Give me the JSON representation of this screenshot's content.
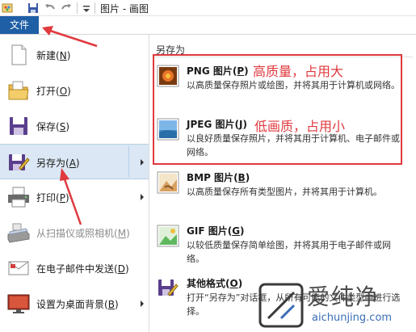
{
  "window": {
    "title": "图片 - 画图"
  },
  "quick_access": {
    "icons": [
      "paint-app-icon",
      "save-icon",
      "undo-icon",
      "redo-icon",
      "customize-dropdown-icon"
    ]
  },
  "file_tab": {
    "label": "文件"
  },
  "left_menu": {
    "items": [
      {
        "label": "新建",
        "key": "N",
        "icon": "new-file-icon",
        "enabled": true,
        "has_submenu": false
      },
      {
        "label": "打开",
        "key": "O",
        "icon": "open-folder-icon",
        "enabled": true,
        "has_submenu": false
      },
      {
        "label": "保存",
        "key": "S",
        "icon": "save-icon",
        "enabled": true,
        "has_submenu": false
      },
      {
        "label": "另存为",
        "key": "A",
        "icon": "save-as-icon",
        "enabled": true,
        "has_submenu": true,
        "active": true
      },
      {
        "label": "打印",
        "key": "P",
        "icon": "printer-icon",
        "enabled": true,
        "has_submenu": true
      },
      {
        "label": "从扫描仪或照相机",
        "key": "M",
        "icon": "scanner-icon",
        "enabled": false,
        "has_submenu": false
      },
      {
        "label": "在电子邮件中发送",
        "key": "D",
        "icon": "email-icon",
        "enabled": true,
        "has_submenu": false
      },
      {
        "label": "设置为桌面背景",
        "key": "B",
        "icon": "desktop-background-icon",
        "enabled": true,
        "has_submenu": true
      }
    ]
  },
  "submenu": {
    "title": "另存为",
    "items": [
      {
        "name": "PNG 图片",
        "key": "P",
        "icon": "png-image-icon",
        "description": "以高质量保存照片或绘图，并将其用于计算机或网络。"
      },
      {
        "name": "JPEG 图片",
        "key": "J",
        "icon": "jpeg-image-icon",
        "description": "以良好质量保存照片，并将其用于计算机、电子邮件或网络。"
      },
      {
        "name": "BMP 图片",
        "key": "B",
        "icon": "bmp-image-icon",
        "description": "以高质量保存所有类型图片，并将其用于计算机。"
      },
      {
        "name": "GIF 图片",
        "key": "G",
        "icon": "gif-image-icon",
        "description": "以较低质量保存简单绘图，并将其用于电子邮件或网络。"
      },
      {
        "name": "其他格式",
        "key": "O",
        "icon": "other-formats-icon",
        "description": "打开“另存为”对话框，从所有可能的文件类型中进行选择。"
      }
    ]
  },
  "annotations": {
    "png_note": "高质量，占用大",
    "jpeg_note": "低画质，占用小",
    "color": "#e0393e"
  },
  "watermark": {
    "cn": "爱纯净",
    "en": "aichunjing.com"
  },
  "colors": {
    "file_tab": "#1f5fa6",
    "active_item": "#dbe7f4",
    "annotation": "#e0393e"
  }
}
